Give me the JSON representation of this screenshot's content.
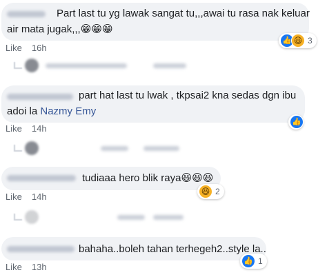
{
  "comments": [
    {
      "text_line1": "Part last tu yg lawak sangat tu,,,awai tu rasa nak keluar",
      "text_line2": "air mata jugak,,,",
      "emoji": "😁😁😁",
      "like_label": "Like",
      "time": "16h",
      "reaction_count": "3",
      "reactions": [
        "like-icon",
        "haha-icon"
      ]
    },
    {
      "text_line1": "part hat last tu lwak , tkpsai2 kna sedas dgn ibu",
      "text_line2_plain": "adoi la ",
      "mention": "Nazmy Emy",
      "like_label": "Like",
      "time": "14h",
      "reaction_count": "",
      "reactions": [
        "like-icon"
      ]
    },
    {
      "text_line1": "tudiaaa hero blik raya",
      "emoji": "😆😆😆",
      "like_label": "Like",
      "time": "14h",
      "reaction_count": "2",
      "reactions": [
        "haha-icon"
      ]
    },
    {
      "text_line1": "bahaha..boleh tahan terhegeh2..style la..",
      "like_label": "Like",
      "time": "13h",
      "reaction_count": "1",
      "reactions": [
        "like-icon"
      ]
    }
  ],
  "colors": {
    "bubble": "#f0f2f5",
    "meta_text": "#606770",
    "mention": "#385898",
    "like_blue": "#1877f2",
    "haha_yellow": "#f7b125"
  }
}
